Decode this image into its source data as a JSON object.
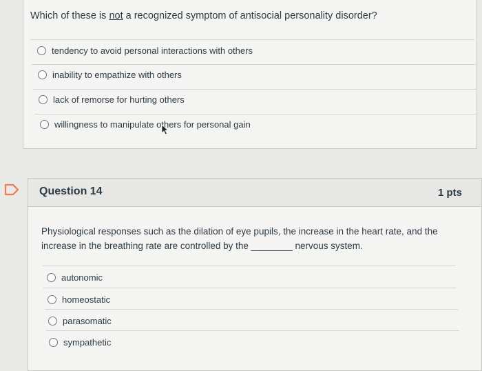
{
  "q13": {
    "text_before": "Which of these is ",
    "text_underlined": "not",
    "text_after": " a recognized symptom of antisocial personality disorder?",
    "options": [
      "tendency to avoid personal interactions with others",
      "inability to empathize with others",
      "lack of remorse for hurting others",
      "willingness to manipulate others for personal gain"
    ]
  },
  "q14": {
    "title": "Question 14",
    "points": "1 pts",
    "text": "Physiological responses such as the dilation of eye pupils, the increase in the heart rate, and the increase in the breathing rate are controlled by the ________ nervous system.",
    "options": [
      "autonomic",
      "homeostatic",
      "parasomatic",
      "sympathetic"
    ]
  },
  "icons": {
    "flag": "bookmark-flag-icon",
    "cursor": "mouse-pointer-icon"
  },
  "colors": {
    "flag": "#ef7a4d",
    "text": "#2d3b45"
  }
}
